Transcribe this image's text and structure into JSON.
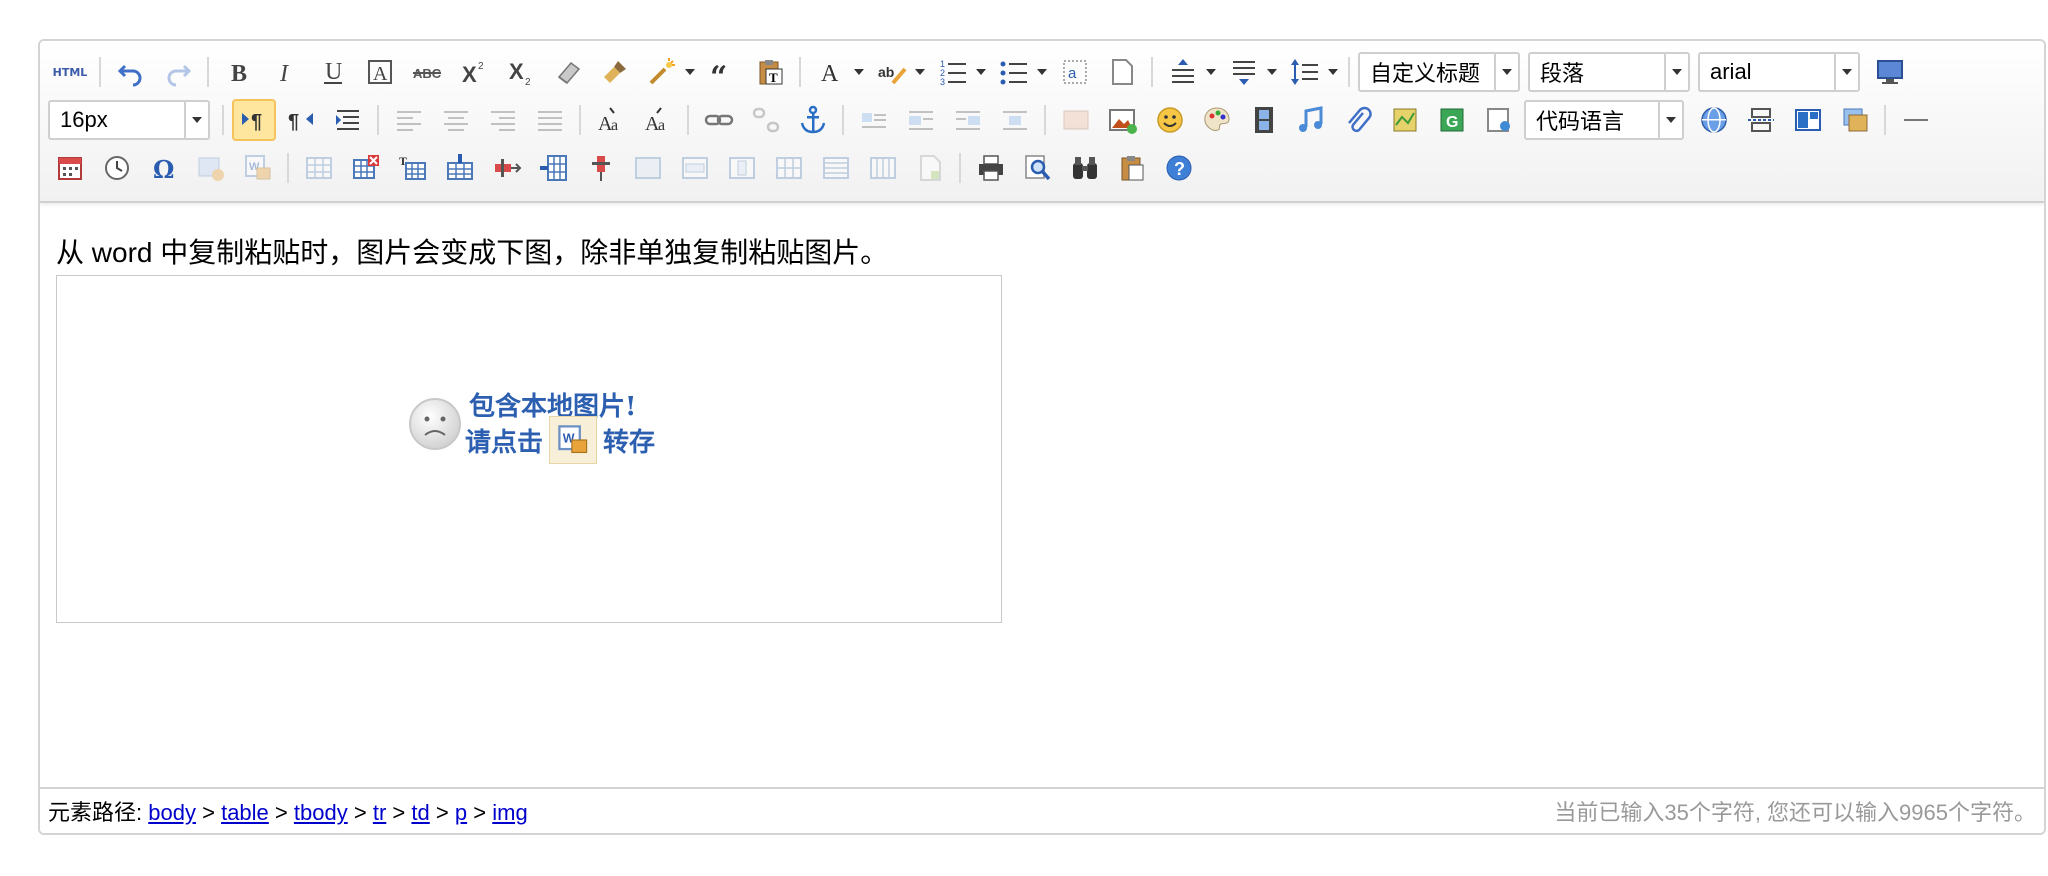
{
  "toolbar": {
    "combos": {
      "custom_heading": "自定义标题",
      "paragraph": "段落",
      "font_family": "arial",
      "font_size": "16px",
      "code_language": "代码语言"
    },
    "html_label": "HTML"
  },
  "content": {
    "text": "从 word 中复制粘贴时，图片会变成下图，除非单独复制粘贴图片。",
    "placeholder_line1": "包含本地图片!",
    "placeholder_line2_a": "请点击",
    "placeholder_line2_b": "转存"
  },
  "statusbar": {
    "path_label": "元素路径:",
    "path": [
      "body",
      "table",
      "tbody",
      "tr",
      "td",
      "p",
      "img"
    ],
    "sep": ">",
    "counter": "当前已输入35个字符, 您还可以输入9965个字符。"
  }
}
